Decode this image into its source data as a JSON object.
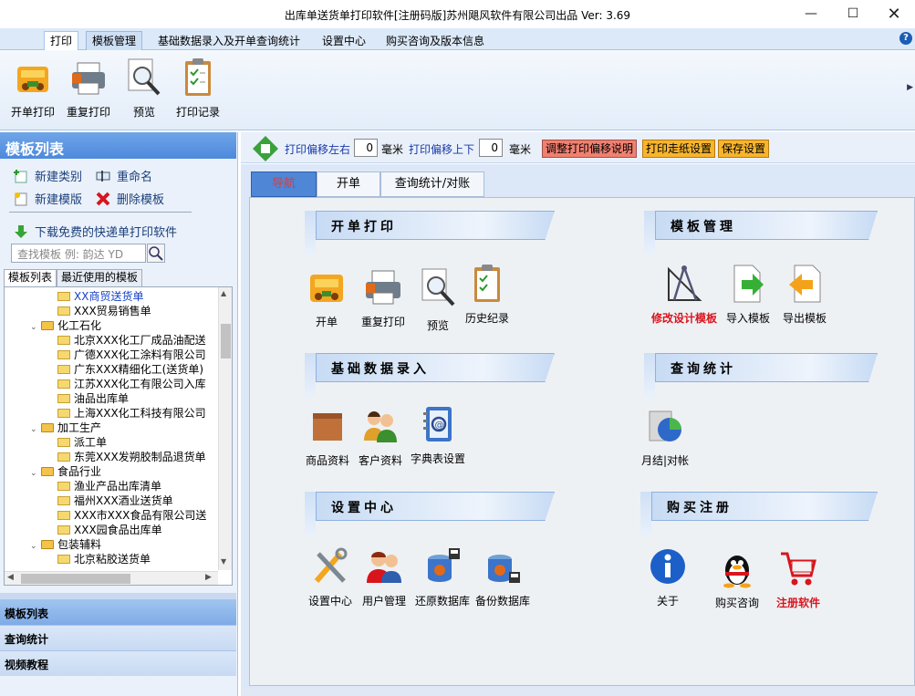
{
  "window": {
    "title": "出库单送货单打印软件[注册码版]苏州飓风软件有限公司出品  Ver: 3.69"
  },
  "ribbon_tabs": [
    {
      "label": "打印"
    },
    {
      "label": "模板管理"
    },
    {
      "label": "基础数据录入及开单查询统计"
    },
    {
      "label": "设置中心"
    },
    {
      "label": "购买咨询及版本信息"
    }
  ],
  "ribbon_buttons": [
    {
      "label": "开单打印",
      "icon": "cash-register-icon"
    },
    {
      "label": "重复打印",
      "icon": "printer-icon"
    },
    {
      "label": "预览",
      "icon": "magnifier-icon"
    },
    {
      "label": "打印记录",
      "icon": "clipboard-icon"
    }
  ],
  "left": {
    "header": "模板列表",
    "actions": {
      "new_category": "新建类别",
      "rename": "重命名",
      "new_template": "新建模版",
      "delete_template": "删除模板",
      "download": "下载免费的快递单打印软件"
    },
    "search_placeholder": "查找模板 例: 韵达 YD",
    "tree_tabs": [
      "模板列表",
      "最近使用的模板"
    ],
    "tree": [
      {
        "text": "XX商贸送货单",
        "type": "file",
        "level": 2,
        "blue": true
      },
      {
        "text": "XXX贸易销售单",
        "type": "file",
        "level": 2
      },
      {
        "text": "化工石化",
        "type": "folder",
        "level": 1
      },
      {
        "text": "北京XXX化工厂成品油配送",
        "type": "file",
        "level": 2
      },
      {
        "text": "广德XXX化工涂料有限公司",
        "type": "file",
        "level": 2
      },
      {
        "text": "广东XXX精细化工(送货单)",
        "type": "file",
        "level": 2
      },
      {
        "text": "江苏XXX化工有限公司入库",
        "type": "file",
        "level": 2
      },
      {
        "text": "油品出库单",
        "type": "file",
        "level": 2
      },
      {
        "text": "上海XXX化工科技有限公司",
        "type": "file",
        "level": 2
      },
      {
        "text": "加工生产",
        "type": "folder",
        "level": 1
      },
      {
        "text": "派工单",
        "type": "file",
        "level": 2
      },
      {
        "text": "东莞XXX发朔胶制品退货单",
        "type": "file",
        "level": 2
      },
      {
        "text": "食品行业",
        "type": "folder",
        "level": 1
      },
      {
        "text": "渔业产品出库清单",
        "type": "file",
        "level": 2
      },
      {
        "text": "福州XXX酒业送货单",
        "type": "file",
        "level": 2
      },
      {
        "text": "XXX市XXX食品有限公司送",
        "type": "file",
        "level": 2
      },
      {
        "text": "XXX园食品出库单",
        "type": "file",
        "level": 2
      },
      {
        "text": "包装辅料",
        "type": "folder",
        "level": 1
      },
      {
        "text": "北京粘胶送货单",
        "type": "file",
        "level": 2
      }
    ],
    "nav": [
      "模板列表",
      "查询统计",
      "视频教程"
    ]
  },
  "offset": {
    "lr_label": "打印偏移左右",
    "lr_value": "0",
    "unit1": "毫米",
    "ud_label": "打印偏移上下",
    "ud_value": "0",
    "unit2": "毫米",
    "btn_help": "调整打印偏移说明",
    "btn_paper": "打印走纸设置",
    "btn_save": "保存设置"
  },
  "content_tabs": [
    "导航",
    "开单",
    "查询统计/对账"
  ],
  "sections": {
    "print": {
      "title": "开单打印",
      "items": [
        "开单",
        "重复打印",
        "预览",
        "历史纪录"
      ]
    },
    "template": {
      "title": "模板管理",
      "items": [
        "修改设计模板",
        "导入模板",
        "导出模板"
      ]
    },
    "basic": {
      "title": "基础数据录入",
      "items": [
        "商品资料",
        "客户资料",
        "字典表设置"
      ]
    },
    "query": {
      "title": "查询统计",
      "items": [
        "月结|对帐"
      ]
    },
    "settings": {
      "title": "设置中心",
      "items": [
        "设置中心",
        "用户管理",
        "还原数据库",
        "备份数据库"
      ]
    },
    "buy": {
      "title": "购买注册",
      "items": [
        "关于",
        "购买咨询",
        "注册软件"
      ]
    }
  },
  "colors": {
    "accent": "#4f86d6",
    "red": "#d8151d"
  }
}
